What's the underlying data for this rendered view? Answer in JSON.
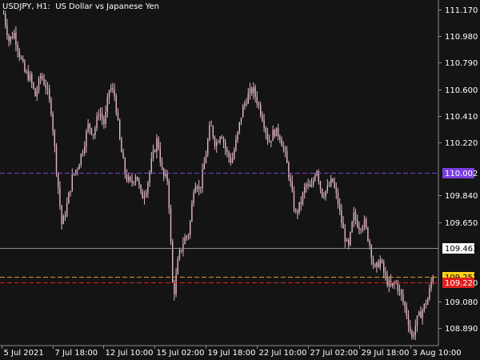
{
  "header": {
    "symbol": "USDJPY, H1:",
    "description": "US Dollar vs Japanese Yen"
  },
  "chart_data": {
    "type": "candlestick",
    "symbol": "USDJPY",
    "timeframe": "H1",
    "title": "US Dollar vs Japanese Yen",
    "ylim": [
      108.76,
      111.22
    ],
    "y_ticks": [
      111.17,
      110.98,
      110.79,
      110.6,
      110.41,
      110.22,
      109.84,
      109.65,
      109.08,
      108.89
    ],
    "y_tick_labels": [
      "111.170",
      "110.980",
      "110.790",
      "110.600",
      "110.410",
      "110.220",
      "109.840",
      "109.650",
      "109.080",
      "108.890"
    ],
    "x_tick_labels": [
      "5 Jul 2021",
      "7 Jul 18:00",
      "12 Jul 10:00",
      "15 Jul 02:00",
      "19 Jul 18:00",
      "22 Jul 10:00",
      "27 Jul 02:00",
      "29 Jul 18:00",
      "3 Aug 10:00"
    ],
    "close_path": [
      111.14,
      110.95,
      111.0,
      110.85,
      110.72,
      110.68,
      110.55,
      110.7,
      110.62,
      110.45,
      110.02,
      109.62,
      109.78,
      109.98,
      110.05,
      110.18,
      110.35,
      110.28,
      110.45,
      110.35,
      110.62,
      110.55,
      110.2,
      109.98,
      109.92,
      110.0,
      109.82,
      109.9,
      110.1,
      110.25,
      109.98,
      109.95,
      109.1,
      109.4,
      109.52,
      109.58,
      109.95,
      109.88,
      110.1,
      110.35,
      110.2,
      110.3,
      110.15,
      110.08,
      110.25,
      110.45,
      110.55,
      110.6,
      110.5,
      110.38,
      110.22,
      110.3,
      110.28,
      110.15,
      109.95,
      109.7,
      109.78,
      109.92,
      109.88,
      110.05,
      109.85,
      109.88,
      109.95,
      109.8,
      109.6,
      109.45,
      109.7,
      109.62,
      109.65,
      109.5,
      109.3,
      109.38,
      109.25,
      109.18,
      109.22,
      109.12,
      109.0,
      108.82,
      108.95,
      109.02,
      109.1,
      109.28
    ],
    "lines": [
      {
        "name": "purple_level",
        "value": 110.002,
        "label": "110.002",
        "color": "#7b3fe0",
        "style": "dashed"
      },
      {
        "name": "gray_level",
        "value": 109.463,
        "label": "109.463",
        "color": "#8c8c8c",
        "style": "solid"
      },
      {
        "name": "orange_level",
        "value": 109.257,
        "label": "109.257",
        "color": "#d4a017",
        "style": "dashed"
      },
      {
        "name": "red_level",
        "value": 109.22,
        "label": "109.220",
        "color": "#e02020",
        "style": "dashed"
      }
    ],
    "colors": {
      "background": "#141414",
      "candle": "#e0b6c3",
      "text": "#ffffff",
      "axis": "#8a8a8a"
    },
    "grid": false
  }
}
